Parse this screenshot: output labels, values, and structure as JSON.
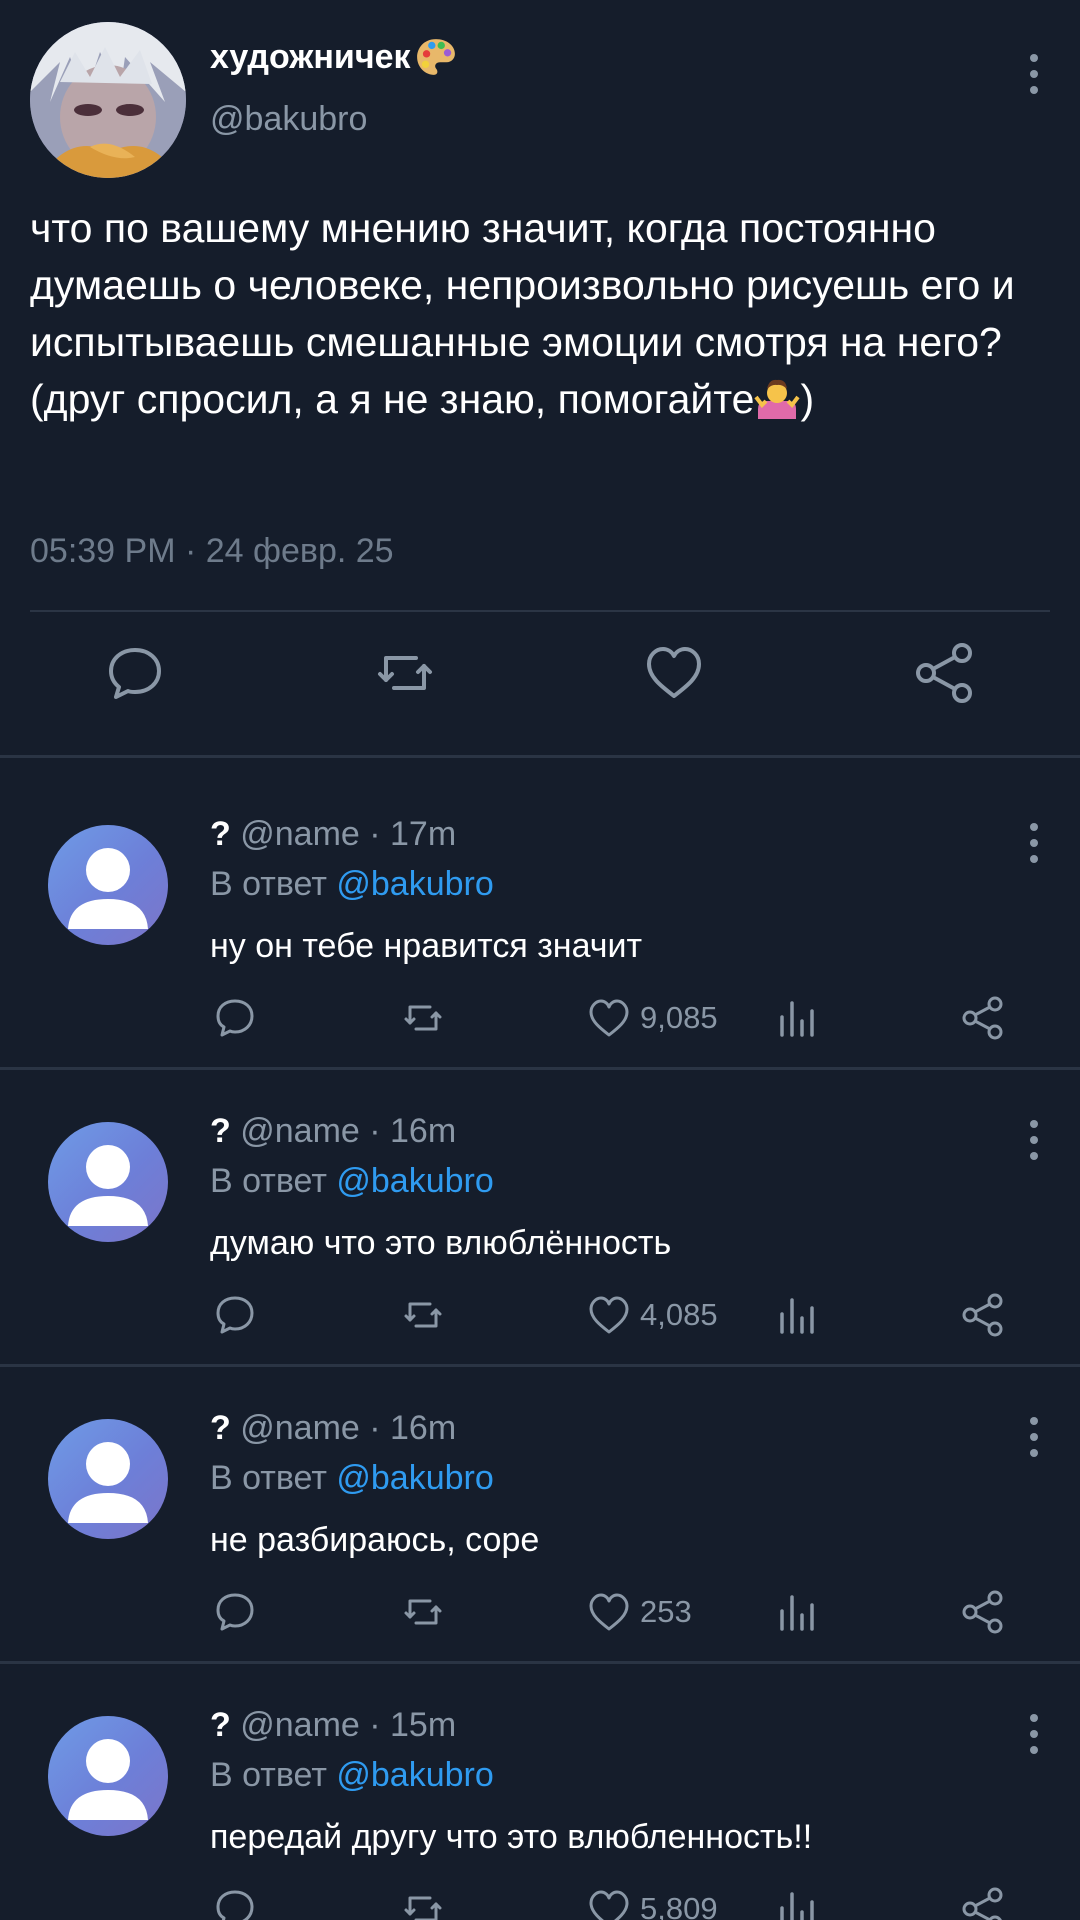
{
  "tweet": {
    "display_name": "художничек",
    "handle": "@bakubro",
    "text": "что по вашему мнению значит, когда постоянно думаешь о человеке, непроизвольно рисуешь его и испытываешь смешанные эмоции смотря на него?(друг спросил, а я не знаю, помогайте",
    "text_after_emoji": ")",
    "timestamp": "05:39 PM · 24 февр. 25"
  },
  "icons": {
    "author_emoji": "artist-palette-icon",
    "shrug_emoji": "person-shrugging-icon",
    "more": "more-vertical-icon",
    "reply": "reply-bubble-icon",
    "retweet": "retweet-icon",
    "like": "heart-icon",
    "share": "share-icon",
    "views": "views-bars-icon"
  },
  "colors": {
    "background": "#151d2b",
    "mention": "#2f9bf0",
    "muted": "#8a97a6",
    "icon": "#8a97a6"
  },
  "replies": [
    {
      "name": "?",
      "meta": "@name · 17m",
      "reply_prefix": "В ответ",
      "reply_mention": "@bakubro",
      "text": "ну он тебе нравится значит",
      "likes": "9,085"
    },
    {
      "name": "?",
      "meta": "@name · 16m",
      "reply_prefix": "В ответ",
      "reply_mention": "@bakubro",
      "text": "думаю что это влюблённость",
      "likes": "4,085"
    },
    {
      "name": "?",
      "meta": "@name · 16m",
      "reply_prefix": "В ответ",
      "reply_mention": "@bakubro",
      "text": "не разбираюсь, соре",
      "likes": "253"
    },
    {
      "name": "?",
      "meta": "@name · 15m",
      "reply_prefix": "В ответ",
      "reply_mention": "@bakubro",
      "text": "передай другу что это влюбленность!!",
      "likes": "5,809"
    }
  ]
}
